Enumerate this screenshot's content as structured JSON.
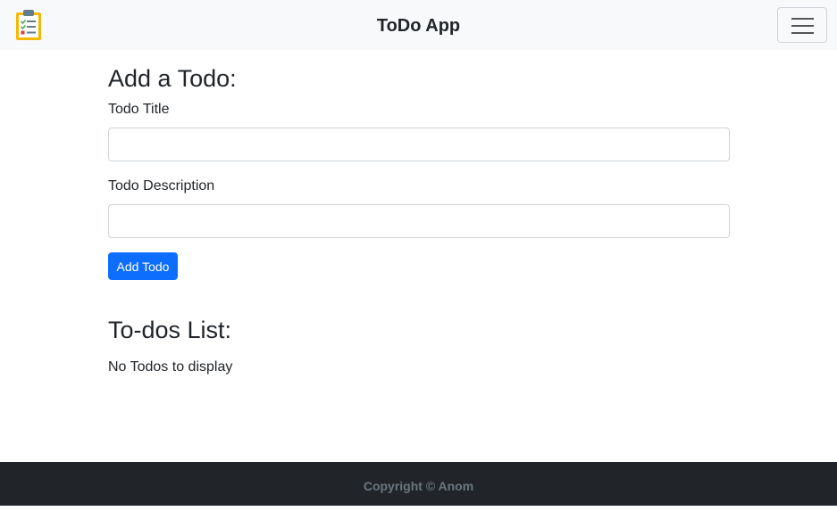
{
  "navbar": {
    "logo_icon": "clipboard-checklist-icon",
    "brand": "ToDo App",
    "toggler_icon": "hamburger-menu-icon"
  },
  "add_section": {
    "heading": "Add a Todo:",
    "title_label": "Todo Title",
    "title_value": "",
    "description_label": "Todo Description",
    "description_value": "",
    "button_label": "Add Todo"
  },
  "list_section": {
    "heading": "To-dos List:",
    "empty_text": "No Todos to display"
  },
  "footer": {
    "copyright": "Copyright © Anom"
  },
  "colors": {
    "navbar_bg": "#f8f9fa",
    "primary": "#0d6efd",
    "footer_bg": "#212529",
    "footer_text": "#6c757d"
  }
}
